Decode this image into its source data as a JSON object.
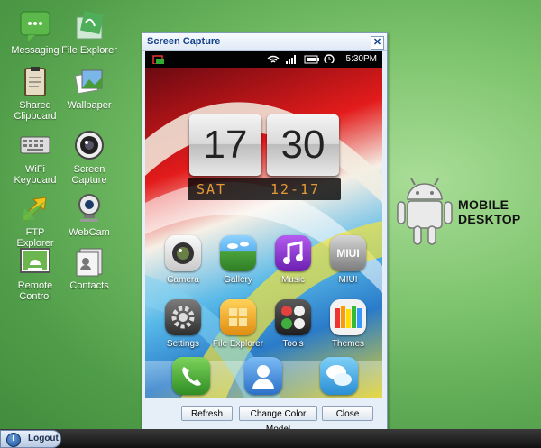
{
  "desktop_icons": [
    {
      "name": "messaging",
      "label": "Messaging",
      "icon": "chat-bubble-icon"
    },
    {
      "name": "file-explorer",
      "label": "File Explorer",
      "icon": "folder-icon"
    },
    {
      "name": "shared-clipboard",
      "label": "Shared\nClipboard",
      "icon": "clipboard-icon"
    },
    {
      "name": "wallpaper",
      "label": "Wallpaper",
      "icon": "photos-icon"
    },
    {
      "name": "wifi-keyboard",
      "label": "WiFi\nKeyboard",
      "icon": "keyboard-icon"
    },
    {
      "name": "screen-capture",
      "label": "Screen\nCapture",
      "icon": "camera-lens-icon"
    },
    {
      "name": "ftp-explorer",
      "label": "FTP Explorer",
      "icon": "arrows-icon"
    },
    {
      "name": "webcam",
      "label": "WebCam",
      "icon": "webcam-icon"
    },
    {
      "name": "remote-control",
      "label": "Remote\nControl",
      "icon": "android-screen-icon"
    },
    {
      "name": "contacts",
      "label": "Contacts",
      "icon": "contacts-icon"
    }
  ],
  "brand": {
    "line1": "MOBILE",
    "line2": "DESKTOP"
  },
  "window": {
    "title": "Screen Capture",
    "close_glyph": "✕",
    "status_time": "5:30PM",
    "clock_hour": "17",
    "clock_minute": "30",
    "clock_day": "SAT",
    "clock_date": "12-17",
    "apps_row1": [
      {
        "label": "Camera",
        "icon": "camera-icon",
        "color": "#dcdcdc"
      },
      {
        "label": "Gallery",
        "icon": "gallery-icon",
        "color": "#4aa23a"
      },
      {
        "label": "Music",
        "icon": "music-icon",
        "color": "#8d2fd6"
      },
      {
        "label": "MIUI",
        "icon": "miui-icon",
        "color": "#9a9a9a"
      }
    ],
    "apps_row2": [
      {
        "label": "Settings",
        "icon": "settings-gear-icon",
        "color": "#5a5a5a"
      },
      {
        "label": "File Explorer",
        "icon": "file-explorer-icon",
        "color": "#f1a51c"
      },
      {
        "label": "Tools",
        "icon": "tools-icon",
        "color": "#3a3a3a"
      },
      {
        "label": "Themes",
        "icon": "themes-icon",
        "color": "#e8e8e8"
      }
    ],
    "dock": [
      {
        "icon": "phone-icon",
        "color": "#4bb038"
      },
      {
        "icon": "contacts-person-icon",
        "color": "#3f8fe0"
      },
      {
        "icon": "sms-icon",
        "color": "#3aa2e0"
      }
    ],
    "buttons": {
      "refresh": "Refresh",
      "change_color": "Change Color Model",
      "close": "Close"
    }
  },
  "taskbar": {
    "logout": "Logout"
  }
}
